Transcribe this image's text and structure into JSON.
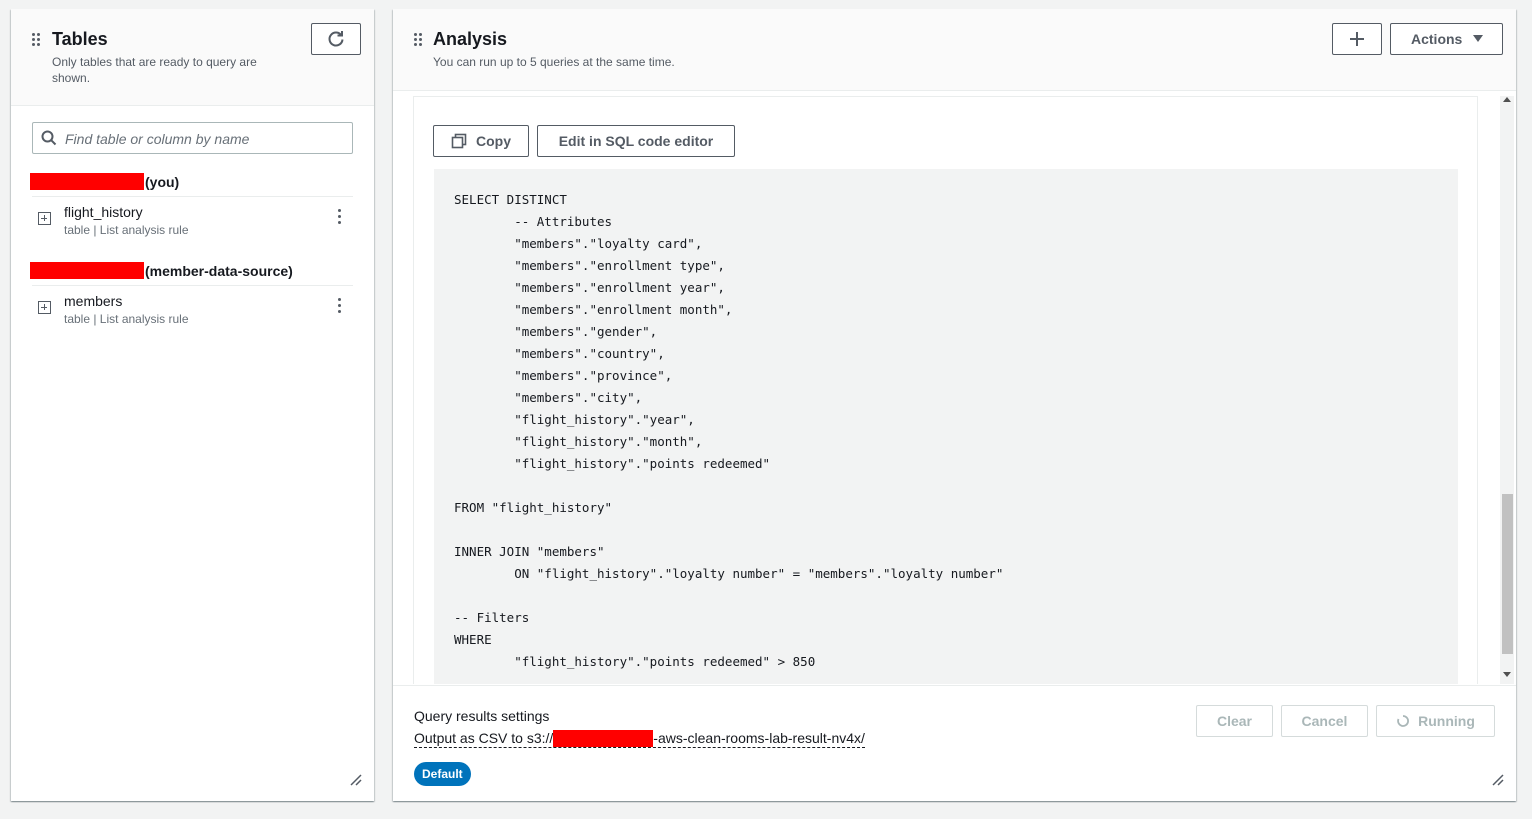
{
  "tables_panel": {
    "title": "Tables",
    "description": "Only tables that are ready to query are shown.",
    "refresh_icon": "refresh-icon",
    "search": {
      "placeholder": "Find table or column by name",
      "value": ""
    },
    "groups": [
      {
        "suffix": "(you)",
        "tables": [
          {
            "name": "flight_history",
            "meta": "table | List analysis rule"
          }
        ]
      },
      {
        "suffix": "(member-data-source)",
        "tables": [
          {
            "name": "members",
            "meta": "table | List analysis rule"
          }
        ]
      }
    ]
  },
  "analysis_panel": {
    "title": "Analysis",
    "description": "You can run up to 5 queries at the same time.",
    "add_icon": "plus-icon",
    "actions_label": "Actions",
    "copy_label": "Copy",
    "edit_label": "Edit in SQL code editor",
    "code": "SELECT DISTINCT\n        -- Attributes\n        \"members\".\"loyalty card\",\n        \"members\".\"enrollment type\",\n        \"members\".\"enrollment year\",\n        \"members\".\"enrollment month\",\n        \"members\".\"gender\",\n        \"members\".\"country\",\n        \"members\".\"province\",\n        \"members\".\"city\",\n        \"flight_history\".\"year\",\n        \"flight_history\".\"month\",\n        \"flight_history\".\"points redeemed\"\n\nFROM \"flight_history\"\n\nINNER JOIN \"members\"\n        ON \"flight_history\".\"loyalty number\" = \"members\".\"loyalty number\"\n\n-- Filters\nWHERE\n        \"flight_history\".\"points redeemed\" > 850",
    "results": {
      "title": "Query results settings",
      "output_prefix": "Output as CSV to s3://",
      "output_suffix": "-aws-clean-rooms-lab-result-nv4x/",
      "badge": "Default"
    },
    "clear_label": "Clear",
    "cancel_label": "Cancel",
    "running_label": "Running"
  }
}
